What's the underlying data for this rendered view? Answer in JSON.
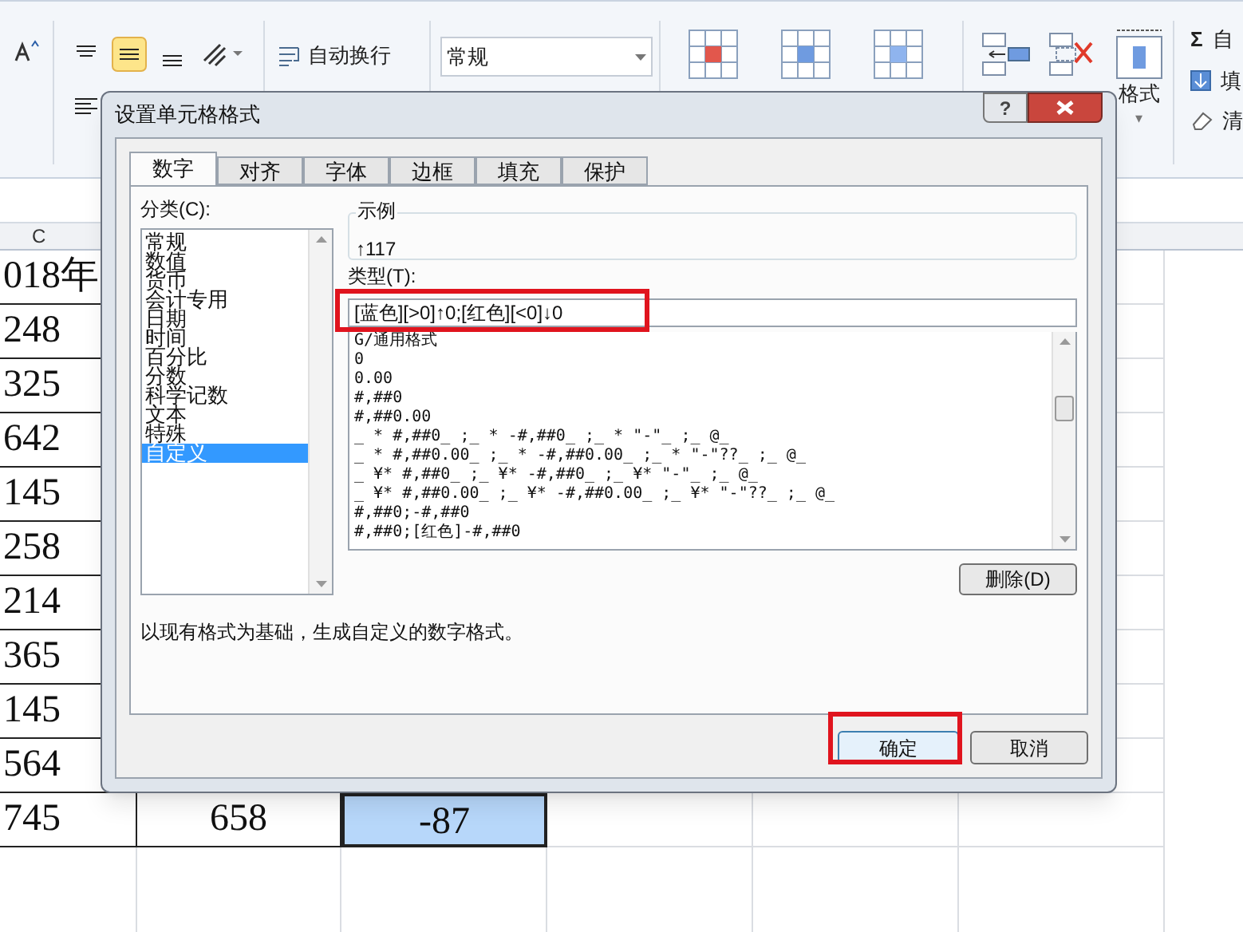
{
  "ribbon": {
    "wrap_text": "自动换行",
    "number_format": "常规",
    "format_label": "格式",
    "format_caret": "▾",
    "sum_symbol": "Σ",
    "side_items": [
      "自",
      "填",
      "清"
    ]
  },
  "sheet": {
    "column_header": "C",
    "rows": [
      {
        "cells": [
          {
            "text": "018年",
            "selected": false
          }
        ]
      },
      {
        "cells": [
          {
            "text": "248",
            "selected": false
          }
        ]
      },
      {
        "cells": [
          {
            "text": "325",
            "selected": false
          }
        ]
      },
      {
        "cells": [
          {
            "text": "642",
            "selected": false
          }
        ]
      },
      {
        "cells": [
          {
            "text": "145",
            "selected": false
          }
        ]
      },
      {
        "cells": [
          {
            "text": "258",
            "selected": false
          }
        ]
      },
      {
        "cells": [
          {
            "text": "214",
            "selected": false
          }
        ]
      },
      {
        "cells": [
          {
            "text": "365",
            "selected": false
          }
        ]
      },
      {
        "cells": [
          {
            "text": "145",
            "selected": false
          }
        ]
      },
      {
        "cells": [
          {
            "text": "564",
            "selected": false
          }
        ]
      },
      {
        "cells": [
          {
            "text": "745",
            "selected": false
          },
          {
            "text": "658",
            "selected": false
          },
          {
            "text": "-87",
            "selected": true
          }
        ]
      }
    ]
  },
  "dialog": {
    "title": "设置单元格格式",
    "help": "?",
    "tabs": [
      {
        "label": "数字",
        "selected": true
      },
      {
        "label": "对齐",
        "selected": false
      },
      {
        "label": "字体",
        "selected": false
      },
      {
        "label": "边框",
        "selected": false
      },
      {
        "label": "填充",
        "selected": false
      },
      {
        "label": "保护",
        "selected": false
      }
    ],
    "category_label": "分类(C):",
    "categories": [
      {
        "label": "常规",
        "selected": false
      },
      {
        "label": "数值",
        "selected": false
      },
      {
        "label": "货币",
        "selected": false
      },
      {
        "label": "会计专用",
        "selected": false
      },
      {
        "label": "日期",
        "selected": false
      },
      {
        "label": "时间",
        "selected": false
      },
      {
        "label": "百分比",
        "selected": false
      },
      {
        "label": "分数",
        "selected": false
      },
      {
        "label": "科学记数",
        "selected": false
      },
      {
        "label": "文本",
        "selected": false
      },
      {
        "label": "特殊",
        "selected": false
      },
      {
        "label": "自定义",
        "selected": true
      }
    ],
    "sample_label": "示例",
    "sample_value": "↑117",
    "type_label": "类型(T):",
    "type_value": "[蓝色][>0]↑0;[红色][<0]↓0",
    "formats": [
      "G/通用格式",
      "0",
      "0.00",
      "#,##0",
      "#,##0.00",
      "_ * #,##0_ ;_ * -#,##0_ ;_ * \"-\"_ ;_ @_",
      "_ * #,##0.00_ ;_ * -#,##0.00_ ;_ * \"-\"??_ ;_ @_",
      "_ ¥* #,##0_ ;_ ¥* -#,##0_ ;_ ¥* \"-\"_ ;_ @_",
      "_ ¥* #,##0.00_ ;_ ¥* -#,##0.00_ ;_ ¥* \"-\"??_ ;_ @_",
      "#,##0;-#,##0",
      "#,##0;[红色]-#,##0"
    ],
    "delete_button": "删除(D)",
    "description": "以现有格式为基础，生成自定义的数字格式。",
    "ok_button": "确定",
    "cancel_button": "取消"
  }
}
